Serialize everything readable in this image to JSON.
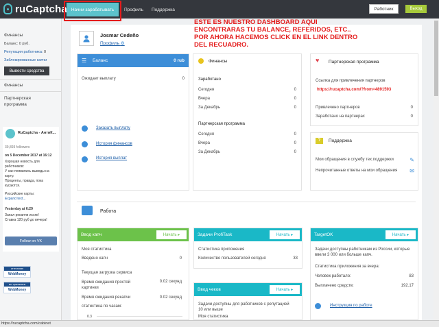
{
  "topbar": {
    "logo": "ruCaptcha",
    "nav": [
      "Начни зарабатывать",
      "Профиль",
      "Поддержка"
    ],
    "worker_button": "Работник",
    "exit_button": "Выход"
  },
  "sidebar": {
    "finance_title": "Финансы",
    "balance": "Баланс: 0 руб.",
    "rep_label": "Репутация работника:",
    "rep_value": "0",
    "blocked_captchas": "Заблокированные капчи",
    "withdraw_button": "Вывести средства",
    "finance_link": "Финансы",
    "partner_program": [
      "Партнерская",
      "программа"
    ],
    "vk": {
      "name": "RuCaptcha - АнтиК...",
      "followers": "39,893 followers",
      "post_date": "on 5 December 2017 at 16:12",
      "post_lines": [
        "Хорошая новость для",
        "работников:",
        "У нас появились выводы на",
        "карту.",
        "Проценты, правда, пока",
        "кусаются."
      ],
      "post2": "Российские карты:",
      "expand": "Expand text...",
      "post3_date": "Yesterday at 6:29",
      "post3_lines": [
        "Запал рекапчи иссяк!",
        "Ставка 120 руб до вечера!"
      ],
      "follow": "Follow on VK"
    },
    "wm_badges": [
      {
        "top": "аттестован",
        "bottom": "WebMoney"
      },
      {
        "top": "мы принимаем",
        "bottom": "WebMoney"
      }
    ]
  },
  "profile": {
    "name": "Josmar Cedeño",
    "link": "Профиль"
  },
  "annotation": "ESTE ES NUESTRO DASHBOARD AQUI ENCONTRARAS TU BALANCE, REFERIDOS, ETC.. POR AHORA HACEMOS CLICK EN EL LINK DENTRO DEL RECUADRO.",
  "balance_card": {
    "title": "Баланс",
    "value": "0 rub",
    "pending_label": "Ожидает выплату",
    "pending_value": "0",
    "links": [
      "Заказать выплату",
      "История финансов",
      "История выплат"
    ]
  },
  "finance_card": {
    "title": "Финансы",
    "earned_title": "Заработано",
    "earned_rows": [
      [
        "Сегодня",
        "0"
      ],
      [
        "Вчера",
        "0"
      ],
      [
        "За Декабрь",
        "0"
      ]
    ],
    "partner_title": "Партнерская программа",
    "partner_rows": [
      [
        "Сегодня",
        "0"
      ],
      [
        "Вчера",
        "0"
      ],
      [
        "За Декабрь",
        "0"
      ]
    ]
  },
  "partner_card": {
    "title": "Партнерская программа",
    "link_label": "Ссылка для привлечения партнеров",
    "ref_link": "https://rucaptcha.com/?from=4891593",
    "rows": [
      [
        "Привлечено партнеров",
        "0"
      ],
      [
        "Заработано на партнерах",
        "0"
      ]
    ]
  },
  "support_card": {
    "title": "Поддержка",
    "rows": [
      "Мои обращения в службу тех.поддержки",
      "Непрочитанные ответы на мои обращения"
    ]
  },
  "work": {
    "title": "Работа",
    "go_label": "Начать",
    "tasks": [
      {
        "title": "Ввод капч",
        "lines": [
          "Моя статистика"
        ],
        "rows": [
          [
            "Введено капч",
            "0"
          ]
        ],
        "section2": "Текущая загрузка сервиса",
        "rows2": [
          [
            "Время ожидания простой картинки",
            "0.02 секунд"
          ],
          [
            "Время ожидания рекапчи",
            "0.02 секунд"
          ]
        ],
        "chart_label": "статистика по часам:",
        "tick": "0.3"
      },
      {
        "title": "Задачи ProfiTask",
        "lines": [
          "Статистика приложения"
        ],
        "rows": [
          [
            "Количество пользователей сегодня",
            "33"
          ]
        ]
      },
      {
        "title": "Ввод чеков",
        "lines": [
          "Задачи доступны для работников с репутацией 10 или выше",
          "Моя статистика"
        ]
      },
      {
        "title": "TargetOK",
        "lines": [
          "Задачи доступны работникам из России, которые ввели 3 000 или больше капч.",
          "Статистика приложения за вчера:"
        ],
        "rows": [
          [
            "Человек работало:",
            "83"
          ],
          [
            "Выплачено средств:",
            "192.17"
          ]
        ],
        "link": "Инструкция по работе"
      }
    ]
  },
  "statusbar": "https://rucaptcha.com/cabinet",
  "colors": {
    "topbar": "#34373d",
    "accent": "#5cc3cc",
    "blue": "#3d8ed8",
    "green": "#6cc24a",
    "teal": "#1ab8c7",
    "highlight": "#e41c1c"
  }
}
